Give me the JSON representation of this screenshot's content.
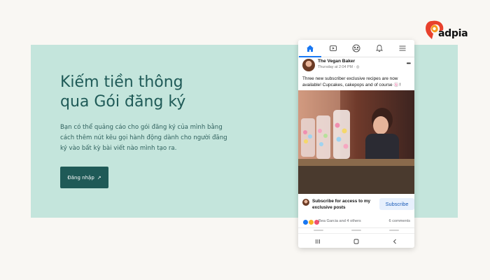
{
  "banner": {
    "headline_line1": "Kiếm tiền thông",
    "headline_line2": "qua Gói đăng ký",
    "description": "Bạn có thể quảng cáo cho gói đăng ký của mình bằng cách thêm nút kêu gọi hành động dành cho người đăng ký vào bất kỳ bài viết nào mình tạo ra.",
    "cta_label": "Đăng nhập",
    "cta_arrow": "↗"
  },
  "logo": {
    "text": "adpia"
  },
  "phone": {
    "post": {
      "page_name": "The Vegan Baker",
      "time": "Thursday at 2:04 PM · ",
      "more": "•••",
      "text": "Three new subscriber exclusive recipes are now available! Cupcakes, cakepops and of course 🍥!"
    },
    "subscribe": {
      "text": "Subscribe for access to my exclusive posts",
      "button": "Subscribe"
    },
    "reactions": {
      "names": "Bea Garcia and 4 others",
      "comments": "6 comments"
    }
  },
  "colors": {
    "banner_bg": "#c4e5dc",
    "headline": "#1f5a57",
    "cta_bg": "#1f5a57",
    "fb_blue": "#1877f2",
    "subscribe_bg": "#e7f0fd"
  },
  "icons": {
    "topnav": [
      "home-icon",
      "video-icon",
      "groups-icon",
      "bell-icon",
      "menu-icon"
    ],
    "sysnav": [
      "recents-icon",
      "home-key-icon",
      "back-icon"
    ]
  }
}
